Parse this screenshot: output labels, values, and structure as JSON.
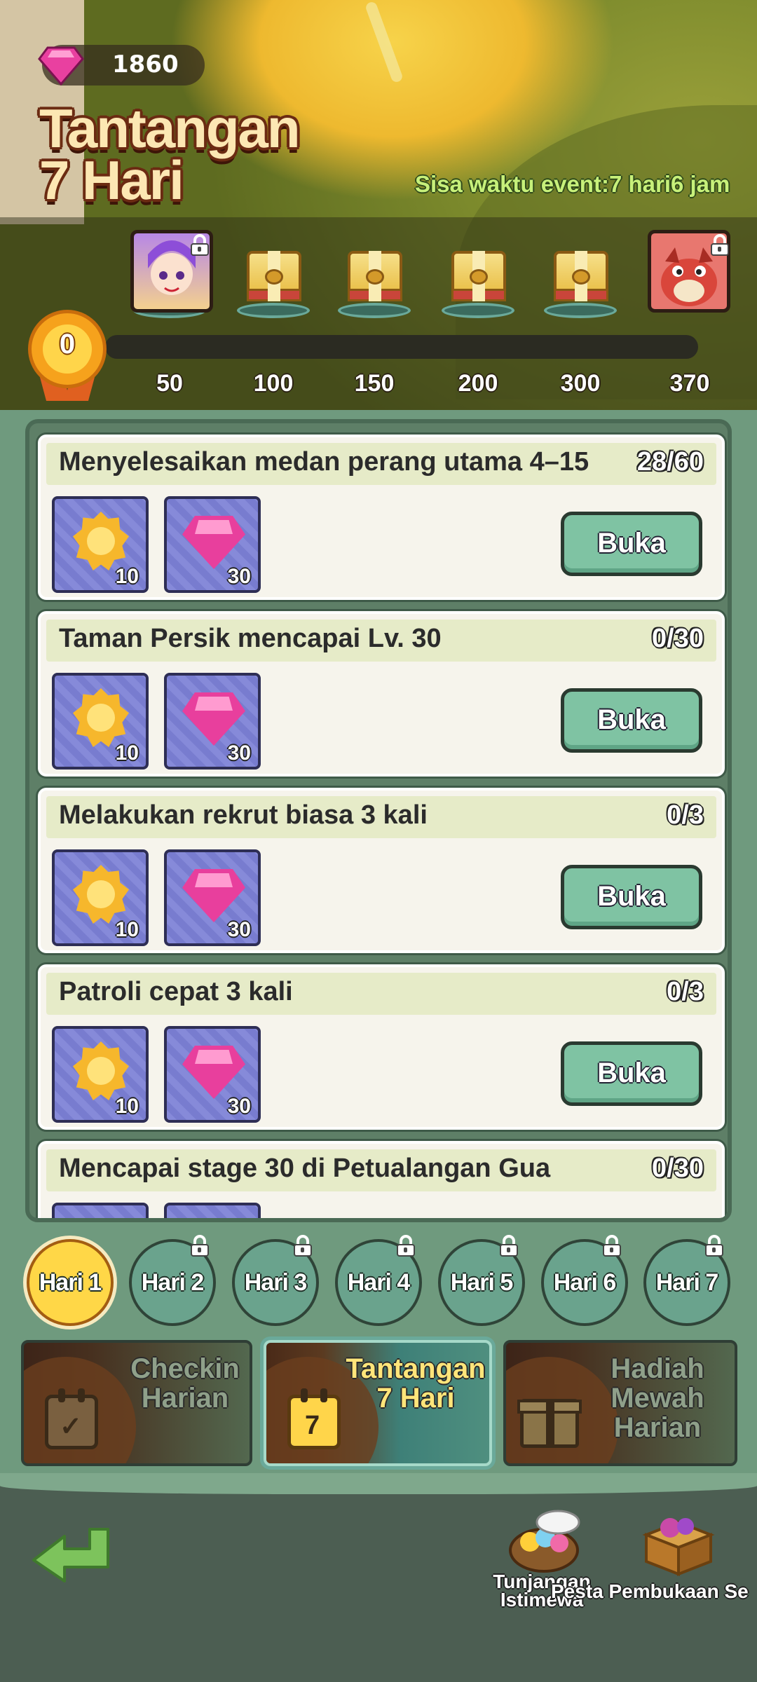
{
  "header": {
    "gem_count": "1860",
    "title_line1": "Tantangan",
    "title_line2": "7 Hari",
    "event_time": "Sisa waktu event:7 hari6 jam"
  },
  "progress": {
    "current_points": "0",
    "fill_fraction": 0,
    "milestones": [
      "50",
      "100",
      "150",
      "200",
      "300",
      "370"
    ],
    "rewards": [
      {
        "type": "character-portrait-purple",
        "locked": true
      },
      {
        "type": "chest",
        "locked": false
      },
      {
        "type": "chest",
        "locked": false
      },
      {
        "type": "chest",
        "locked": false
      },
      {
        "type": "chest",
        "locked": false
      },
      {
        "type": "character-portrait-red",
        "locked": true
      }
    ]
  },
  "tasks": [
    {
      "title": "Menyelesaikan medan perang utama 4–15",
      "progress": "28/60",
      "rewards": [
        {
          "icon": "star-medal-icon",
          "qty": "10"
        },
        {
          "icon": "gem-icon",
          "qty": "30"
        }
      ],
      "button": "Buka"
    },
    {
      "title": "Taman Persik mencapai Lv. 30",
      "progress": "0/30",
      "rewards": [
        {
          "icon": "star-medal-icon",
          "qty": "10"
        },
        {
          "icon": "gem-icon",
          "qty": "30"
        }
      ],
      "button": "Buka"
    },
    {
      "title": "Melakukan rekrut biasa 3 kali",
      "progress": "0/3",
      "rewards": [
        {
          "icon": "star-medal-icon",
          "qty": "10"
        },
        {
          "icon": "gem-icon",
          "qty": "30"
        }
      ],
      "button": "Buka"
    },
    {
      "title": "Patroli cepat 3 kali",
      "progress": "0/3",
      "rewards": [
        {
          "icon": "star-medal-icon",
          "qty": "10"
        },
        {
          "icon": "gem-icon",
          "qty": "30"
        }
      ],
      "button": "Buka"
    },
    {
      "title": "Mencapai stage 30 di Petualangan Gua",
      "progress": "0/30",
      "rewards": [],
      "button": ""
    }
  ],
  "days": [
    {
      "label": "Hari 1",
      "active": true,
      "locked": false
    },
    {
      "label": "Hari 2",
      "active": false,
      "locked": true
    },
    {
      "label": "Hari 3",
      "active": false,
      "locked": true
    },
    {
      "label": "Hari 4",
      "active": false,
      "locked": true
    },
    {
      "label": "Hari 5",
      "active": false,
      "locked": true
    },
    {
      "label": "Hari 6",
      "active": false,
      "locked": true
    },
    {
      "label": "Hari 7",
      "active": false,
      "locked": true
    }
  ],
  "categories": [
    {
      "line1": "Checkin",
      "line2": "Harian",
      "icon": "calendar-check-icon",
      "active": false
    },
    {
      "line1": "Tantangan",
      "line2": "7 Hari",
      "icon": "calendar-7-icon",
      "active": true
    },
    {
      "line1": "Hadiah Mewah",
      "line2": "Harian",
      "icon": "gift-icon",
      "active": false
    }
  ],
  "footer": {
    "back_icon": "back-arrow-icon",
    "shops": [
      {
        "label_line1": "Tunjangan",
        "label_line2": "Istimewa",
        "icon": "candy-basket-icon"
      },
      {
        "label_line1": "Pesta Pembukaan Se",
        "label_line2": "",
        "icon": "gift-box-icon"
      }
    ]
  },
  "colors": {
    "accent_green": "#7fc3a3",
    "active_day": "#ffd747",
    "title_cream": "#fce7b3",
    "event_time_green": "#c7f07a"
  }
}
